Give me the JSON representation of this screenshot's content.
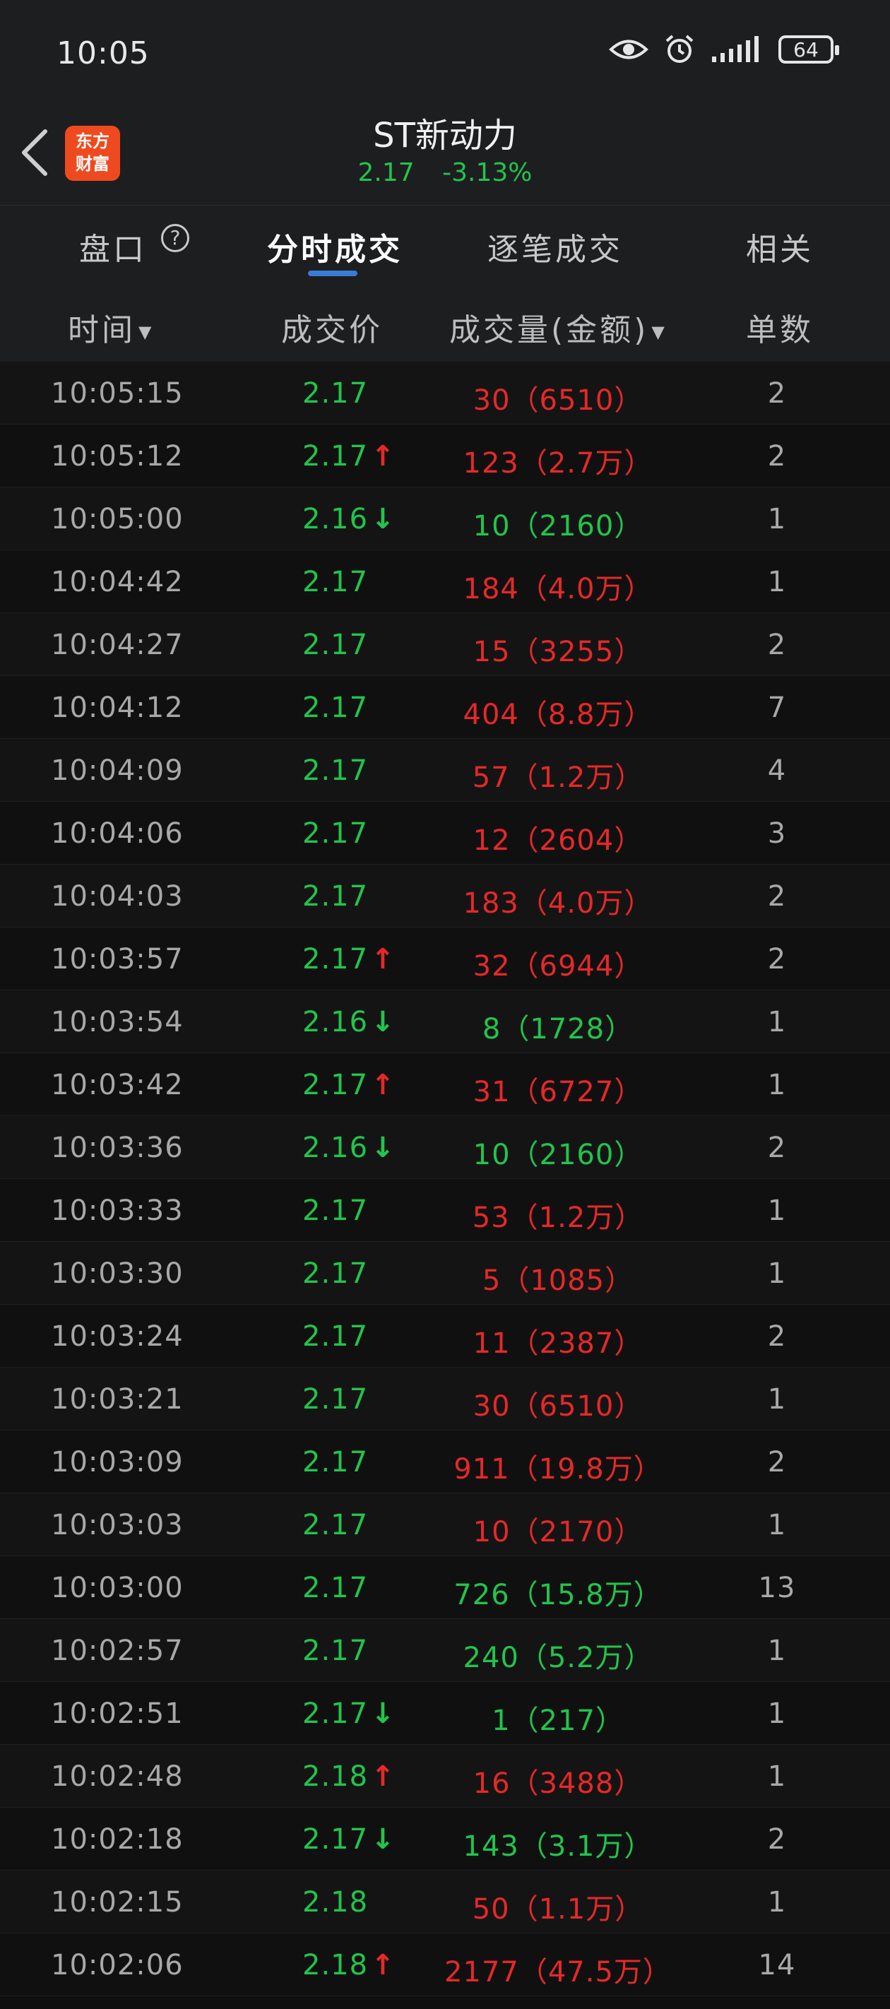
{
  "status": {
    "time": "10:05",
    "battery": "64"
  },
  "header": {
    "logo_line1": "东方",
    "logo_line2": "财富",
    "title": "ST新动力",
    "price": "2.17",
    "change": "-3.13%"
  },
  "tabs": [
    {
      "label": "盘口"
    },
    {
      "label": "分时成交"
    },
    {
      "label": "逐笔成交"
    },
    {
      "label": "相关"
    }
  ],
  "help_icon": "?",
  "columns": {
    "time": "时间",
    "price": "成交价",
    "volume": "成交量(金额)",
    "count": "单数"
  },
  "colors": {
    "up": "#e62828",
    "down": "#22c44c",
    "accent": "#3a7bd5",
    "brand": "#ef4a1f"
  },
  "trades": [
    {
      "time": "10:05:15",
      "price": "2.17",
      "arrow": "",
      "volume": "30（6510）",
      "vol_color": "red",
      "count": "2"
    },
    {
      "time": "10:05:12",
      "price": "2.17",
      "arrow": "↑",
      "volume": "123（2.7万）",
      "vol_color": "red",
      "count": "2"
    },
    {
      "time": "10:05:00",
      "price": "2.16",
      "arrow": "↓",
      "volume": "10（2160）",
      "vol_color": "green",
      "count": "1"
    },
    {
      "time": "10:04:42",
      "price": "2.17",
      "arrow": "",
      "volume": "184（4.0万）",
      "vol_color": "red",
      "count": "1"
    },
    {
      "time": "10:04:27",
      "price": "2.17",
      "arrow": "",
      "volume": "15（3255）",
      "vol_color": "red",
      "count": "2"
    },
    {
      "time": "10:04:12",
      "price": "2.17",
      "arrow": "",
      "volume": "404（8.8万）",
      "vol_color": "red",
      "count": "7"
    },
    {
      "time": "10:04:09",
      "price": "2.17",
      "arrow": "",
      "volume": "57（1.2万）",
      "vol_color": "red",
      "count": "4"
    },
    {
      "time": "10:04:06",
      "price": "2.17",
      "arrow": "",
      "volume": "12（2604）",
      "vol_color": "red",
      "count": "3"
    },
    {
      "time": "10:04:03",
      "price": "2.17",
      "arrow": "",
      "volume": "183（4.0万）",
      "vol_color": "red",
      "count": "2"
    },
    {
      "time": "10:03:57",
      "price": "2.17",
      "arrow": "↑",
      "volume": "32（6944）",
      "vol_color": "red",
      "count": "2"
    },
    {
      "time": "10:03:54",
      "price": "2.16",
      "arrow": "↓",
      "volume": "8（1728）",
      "vol_color": "green",
      "count": "1"
    },
    {
      "time": "10:03:42",
      "price": "2.17",
      "arrow": "↑",
      "volume": "31（6727）",
      "vol_color": "red",
      "count": "1"
    },
    {
      "time": "10:03:36",
      "price": "2.16",
      "arrow": "↓",
      "volume": "10（2160）",
      "vol_color": "green",
      "count": "2"
    },
    {
      "time": "10:03:33",
      "price": "2.17",
      "arrow": "",
      "volume": "53（1.2万）",
      "vol_color": "red",
      "count": "1"
    },
    {
      "time": "10:03:30",
      "price": "2.17",
      "arrow": "",
      "volume": "5（1085）",
      "vol_color": "red",
      "count": "1"
    },
    {
      "time": "10:03:24",
      "price": "2.17",
      "arrow": "",
      "volume": "11（2387）",
      "vol_color": "red",
      "count": "2"
    },
    {
      "time": "10:03:21",
      "price": "2.17",
      "arrow": "",
      "volume": "30（6510）",
      "vol_color": "red",
      "count": "1"
    },
    {
      "time": "10:03:09",
      "price": "2.17",
      "arrow": "",
      "volume": "911（19.8万）",
      "vol_color": "red",
      "count": "2"
    },
    {
      "time": "10:03:03",
      "price": "2.17",
      "arrow": "",
      "volume": "10（2170）",
      "vol_color": "red",
      "count": "1"
    },
    {
      "time": "10:03:00",
      "price": "2.17",
      "arrow": "",
      "volume": "726（15.8万）",
      "vol_color": "green",
      "count": "13"
    },
    {
      "time": "10:02:57",
      "price": "2.17",
      "arrow": "",
      "volume": "240（5.2万）",
      "vol_color": "green",
      "count": "1"
    },
    {
      "time": "10:02:51",
      "price": "2.17",
      "arrow": "↓",
      "volume": "1（217）",
      "vol_color": "green",
      "count": "1"
    },
    {
      "time": "10:02:48",
      "price": "2.18",
      "arrow": "↑",
      "volume": "16（3488）",
      "vol_color": "red",
      "count": "1"
    },
    {
      "time": "10:02:18",
      "price": "2.17",
      "arrow": "↓",
      "volume": "143（3.1万）",
      "vol_color": "green",
      "count": "2"
    },
    {
      "time": "10:02:15",
      "price": "2.18",
      "arrow": "",
      "volume": "50（1.1万）",
      "vol_color": "red",
      "count": "1"
    },
    {
      "time": "10:02:06",
      "price": "2.18",
      "arrow": "↑",
      "volume": "2177（47.5万）",
      "vol_color": "red",
      "count": "14"
    }
  ]
}
